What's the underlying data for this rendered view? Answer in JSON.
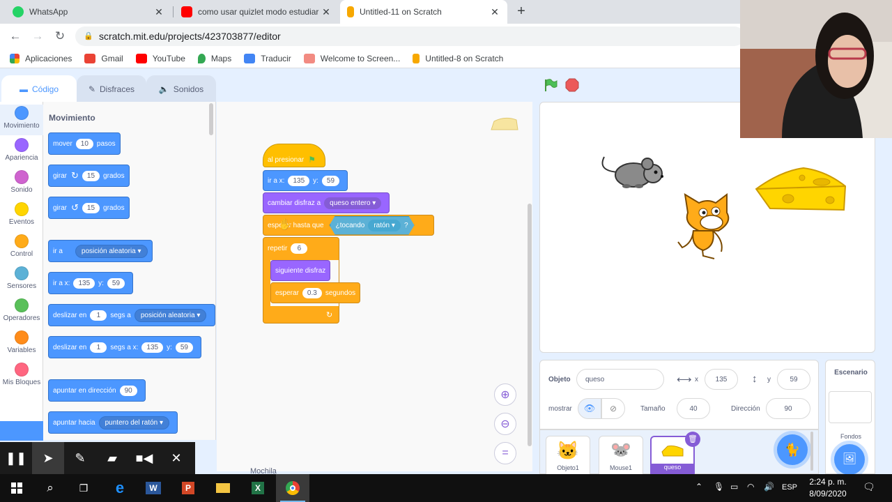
{
  "browser": {
    "tabs": [
      {
        "title": "WhatsApp",
        "icon": "whatsapp-icon",
        "color": "#25d366",
        "active": false
      },
      {
        "title": "como usar quizlet modo estudiar",
        "icon": "youtube-icon",
        "color": "#ff0000",
        "active": false
      },
      {
        "title": "Untitled-11 on Scratch",
        "icon": "scratch-icon",
        "color": "#f7a800",
        "active": true
      }
    ],
    "url": "scratch.mit.edu/projects/423703877/editor",
    "bookmarks": [
      {
        "label": "Aplicaciones",
        "icon": "apps-grid-icon"
      },
      {
        "label": "Gmail",
        "icon": "gmail-icon"
      },
      {
        "label": "YouTube",
        "icon": "youtube-icon"
      },
      {
        "label": "Maps",
        "icon": "maps-icon"
      },
      {
        "label": "Traducir",
        "icon": "translate-icon"
      },
      {
        "label": "Welcome to Screen...",
        "icon": "screencast-icon"
      },
      {
        "label": "Untitled-8 on Scratch",
        "icon": "scratch-icon"
      }
    ]
  },
  "scratch": {
    "tabs": {
      "code": "Código",
      "costumes": "Disfraces",
      "sounds": "Sonidos"
    },
    "categories": [
      {
        "label": "Movimiento",
        "color": "#4c97ff"
      },
      {
        "label": "Apariencia",
        "color": "#9966ff"
      },
      {
        "label": "Sonido",
        "color": "#cf63cf"
      },
      {
        "label": "Eventos",
        "color": "#ffd500"
      },
      {
        "label": "Control",
        "color": "#ffab19"
      },
      {
        "label": "Sensores",
        "color": "#5cb1d6"
      },
      {
        "label": "Operadores",
        "color": "#59c059"
      },
      {
        "label": "Variables",
        "color": "#ff8c1a"
      },
      {
        "label": "Mis Bloques",
        "color": "#ff6680"
      }
    ],
    "palette": {
      "heading": "Movimiento",
      "move": {
        "a": "mover",
        "v": "10",
        "b": "pasos"
      },
      "turn_right": {
        "a": "girar",
        "v": "15",
        "b": "grados"
      },
      "turn_left": {
        "a": "girar",
        "v": "15",
        "b": "grados"
      },
      "goto": {
        "a": "ir a",
        "d": "posición aleatoria"
      },
      "goto_xy": {
        "a": "ir a x:",
        "x": "135",
        "b": "y:",
        "y": "59"
      },
      "glide": {
        "a": "deslizar en",
        "v": "1",
        "b": "segs a",
        "d": "posición aleatoria"
      },
      "glide_xy": {
        "a": "deslizar en",
        "v": "1",
        "b": "segs a x:",
        "x": "135",
        "c": "y:",
        "y": "59"
      },
      "point_dir": {
        "a": "apuntar en dirección",
        "v": "90"
      },
      "point_to": {
        "a": "apuntar hacia",
        "d": "puntero del ratón"
      }
    },
    "script": {
      "hat": "al presionar",
      "goto_xy": {
        "a": "ir a x:",
        "x": "135",
        "b": "y:",
        "y": "59"
      },
      "costume": {
        "a": "cambiar disfraz a",
        "d": "queso entero"
      },
      "wait_until": {
        "a": "esperar hasta que",
        "op": "¿tocando",
        "d": "ratón",
        "q": "?"
      },
      "repeat": {
        "a": "repetir",
        "v": "6"
      },
      "next_costume": "siguiente disfraz",
      "wait": {
        "a": "esperar",
        "v": "0.3",
        "b": "segundos"
      }
    },
    "sprite_info": {
      "object_label": "Objeto",
      "object_value": "queso",
      "x_label": "x",
      "x_value": "135",
      "y_label": "y",
      "y_value": "59",
      "show_label": "mostrar",
      "size_label": "Tamaño",
      "size_value": "40",
      "direction_label": "Dirección",
      "direction_value": "90"
    },
    "sprites": [
      {
        "name": "Objeto1",
        "selected": false
      },
      {
        "name": "Mouse1",
        "selected": false
      },
      {
        "name": "queso",
        "selected": true
      }
    ],
    "stage_pane": {
      "title": "Escenario",
      "backdrops": "Fondos"
    },
    "below_workspace": "Mochila"
  },
  "taskbar": {
    "lang": "ESP",
    "time": "2:24 p. m.",
    "date": "8/09/2020"
  }
}
